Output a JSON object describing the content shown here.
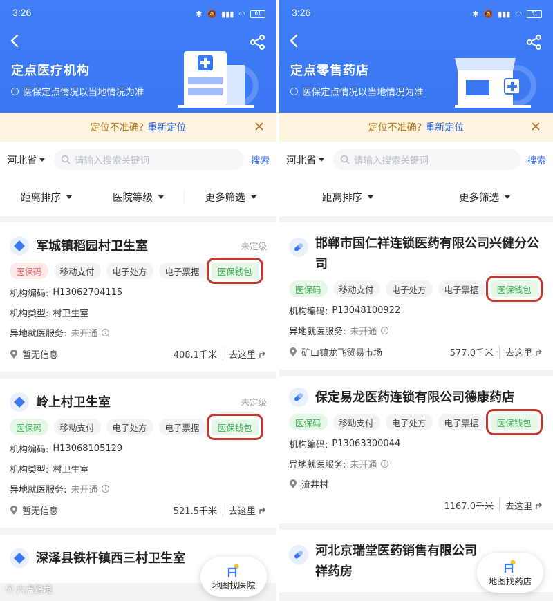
{
  "screens": [
    {
      "status_time": "3:26",
      "battery": "61",
      "hero_title": "定点医疗机构",
      "hero_note": "医保定点情况以当地情况为准",
      "loc_warn": "定位不准确?",
      "loc_link": "重新定位",
      "province": "河北省",
      "search_placeholder": "请输入搜索关键词",
      "search_button": "搜索",
      "filters": [
        "距离排序",
        "医院等级",
        "更多筛选"
      ],
      "cards": [
        {
          "name": "军城镇稻园村卫生室",
          "level": "未定级",
          "tags": [
            "医保码",
            "移动支付",
            "电子处方",
            "电子票据",
            "医保钱包"
          ],
          "code_label": "机构编码:",
          "code": "H13062704115",
          "type_label": "机构类型:",
          "type": "村卫生室",
          "remote_label": "异地就医服务:",
          "remote": "未开通",
          "address": "暂无信息",
          "distance": "408.1千米",
          "go": "去这里"
        },
        {
          "name": "岭上村卫生室",
          "level": "未定级",
          "tags": [
            "医保码",
            "移动支付",
            "电子处方",
            "电子票据",
            "医保钱包"
          ],
          "code_label": "机构编码:",
          "code": "H13068105129",
          "type_label": "机构类型:",
          "type": "村卫生室",
          "remote_label": "异地就医服务:",
          "remote": "未开通",
          "address": "暂无信息",
          "distance": "521.5千米",
          "go": "去这里"
        },
        {
          "name": "深泽县铁杆镇西三村卫生室"
        }
      ],
      "map_button": "地图找医院",
      "watermark": "六点跨境"
    },
    {
      "status_time": "3:26",
      "battery": "61",
      "hero_title": "定点零售药店",
      "hero_note": "医保定点情况以当地情况为准",
      "loc_warn": "定位不准确?",
      "loc_link": "重新定位",
      "province": "河北省",
      "search_placeholder": "请输入搜索关键词",
      "search_button": "搜索",
      "filters": [
        "距离排序",
        "更多筛选"
      ],
      "cards": [
        {
          "name": "邯郸市国仁祥连锁医药有限公司兴健分公司",
          "tags": [
            "医保码",
            "移动支付",
            "电子处方",
            "电子票据",
            "医保钱包"
          ],
          "code_label": "机构编码:",
          "code": "P13048100922",
          "remote_label": "异地就医服务:",
          "remote": "未开通",
          "address": "矿山镇龙飞贸易市场",
          "distance": "577.0千米",
          "go": "去这里"
        },
        {
          "name": "保定易龙医药连锁有限公司德康药店",
          "tags": [
            "医保码",
            "移动支付",
            "电子处方",
            "电子票据",
            "医保钱包"
          ],
          "code_label": "机构编码:",
          "code": "P13063300044",
          "remote_label": "异地就医服务:",
          "remote": "未开通",
          "address": "流井村",
          "distance": "1167.0千米",
          "go": "去这里"
        },
        {
          "name": "河北京瑞堂医药销售有限公司祥药房"
        }
      ],
      "map_button": "地图找药店"
    }
  ],
  "colors": {
    "primary": "#3a78f3",
    "link": "#2a66e8",
    "green_tag": "#3db455",
    "red_tag": "#e2646d",
    "highlight_box": "#c0392b"
  },
  "icons": [
    "back-icon",
    "share-icon",
    "search-icon",
    "close-icon",
    "pin-icon",
    "navigate-icon",
    "map-marker-icon",
    "clinic-icon",
    "pill-icon"
  ]
}
